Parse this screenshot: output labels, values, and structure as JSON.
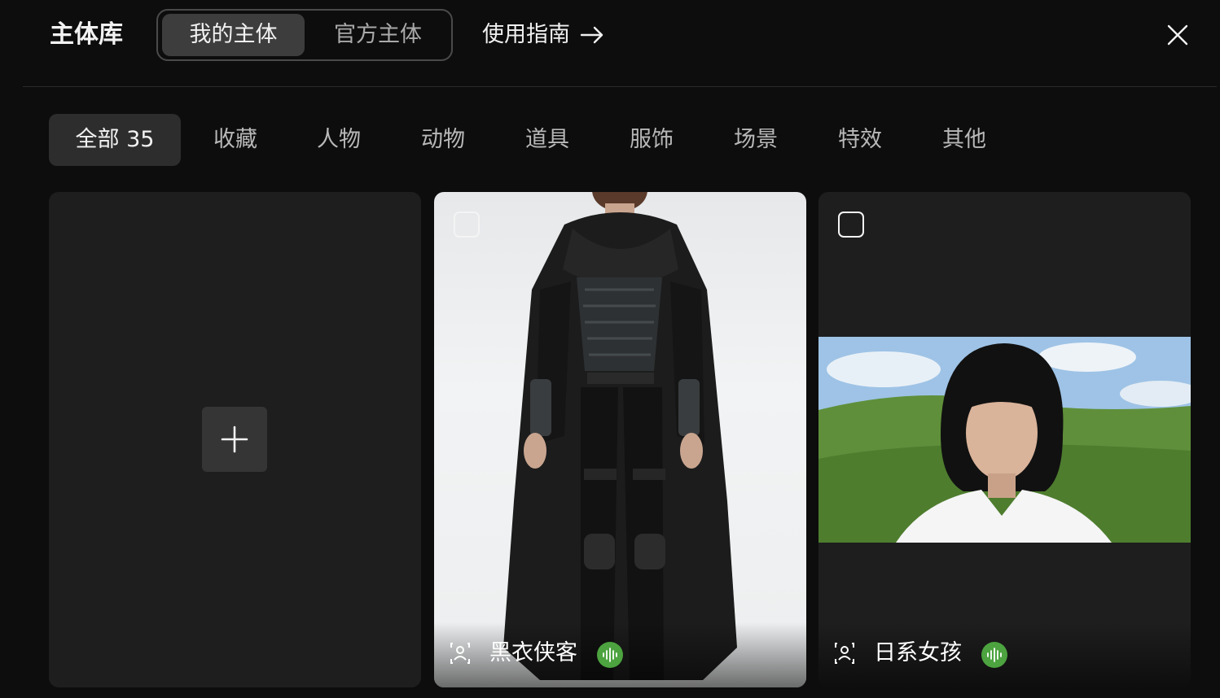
{
  "header": {
    "title": "主体库",
    "segments": [
      {
        "label": "我的主体",
        "active": true
      },
      {
        "label": "官方主体",
        "active": false
      }
    ],
    "guide_label": "使用指南"
  },
  "tabs": [
    {
      "label": "全部 35",
      "active": true
    },
    {
      "label": "收藏"
    },
    {
      "label": "人物"
    },
    {
      "label": "动物"
    },
    {
      "label": "道具"
    },
    {
      "label": "服饰"
    },
    {
      "label": "场景"
    },
    {
      "label": "特效"
    },
    {
      "label": "其他"
    }
  ],
  "cards": [
    {
      "type": "add"
    },
    {
      "type": "subject",
      "name": "黑衣侠客",
      "has_voice": true
    },
    {
      "type": "subject",
      "name": "日系女孩",
      "has_voice": true
    }
  ],
  "colors": {
    "background": "#0d0d0d",
    "card": "#1e1e1e",
    "active_tab": "#2d2d2d",
    "voice_badge": "#4ca33f"
  },
  "icons": [
    "arrow-right-icon",
    "close-icon",
    "plus-icon",
    "person-icon",
    "voice-wave-icon"
  ]
}
